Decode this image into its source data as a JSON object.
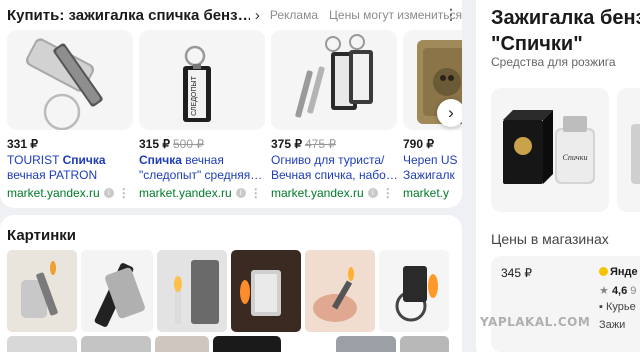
{
  "shopping": {
    "title": "Купить: зажигалка спичка бенз…",
    "ad_label": "Реклама",
    "price_note": "Цены могут измениться",
    "products": [
      {
        "price": "331 ₽",
        "old_price": "",
        "line1_pre": "TOURIST ",
        "line1_bold": "Спичка",
        "line1_post": "",
        "line2": "вечная PATRON",
        "host": "market.yandex.ru"
      },
      {
        "price": "315 ₽",
        "old_price": "500 ₽",
        "line1_pre": "",
        "line1_bold": "Спичка",
        "line1_post": " вечная",
        "line2": "\"следопыт\" средняя…",
        "host": "market.yandex.ru"
      },
      {
        "price": "375 ₽",
        "old_price": "475 ₽",
        "line1_pre": "Огниво для туриста/",
        "line1_bold": "",
        "line1_post": "",
        "line2": "Вечная спичка, набо…",
        "host": "market.yandex.ru"
      },
      {
        "price": "790 ₽",
        "old_price": "",
        "line1_pre": "Череп US",
        "line1_bold": "",
        "line1_post": "",
        "line2": "Зажигалк",
        "host": "market.y"
      }
    ]
  },
  "images": {
    "title": "Картинки"
  },
  "right_panel": {
    "title_line1": "Зажигалка бенз",
    "title_line2": "\"Спички\"",
    "subtitle": "Средства для розжига",
    "prices_title": "Цены в магазинах",
    "offer": {
      "price": "345 ₽",
      "shop": "Янде",
      "rating": "4,6",
      "rating_count": "9",
      "delivery": "Курье",
      "delivery2": "Зажи"
    }
  },
  "watermark": "YAPLAKAL.COM",
  "icons": {
    "chevron": "chevron-right-icon",
    "next": "arrow-right-icon",
    "more": "more-dots-icon"
  }
}
